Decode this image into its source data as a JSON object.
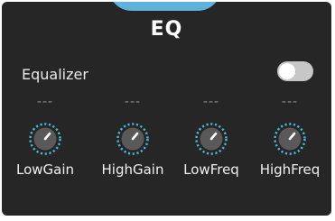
{
  "header": {
    "title": "EQ"
  },
  "equalizer": {
    "label": "Equalizer",
    "enabled": false
  },
  "knobs": [
    {
      "label": "LowGain",
      "value": "---"
    },
    {
      "label": "HighGain",
      "value": "---"
    },
    {
      "label": "LowFreq",
      "value": "---"
    },
    {
      "label": "HighFreq",
      "value": "---"
    }
  ],
  "colors": {
    "panel_bg": "#262626",
    "accent": "#5fb2d9",
    "knob_ring": "#4ab5d4",
    "knob_body": "#595959",
    "text": "#ffffff",
    "muted": "#8c8c8c",
    "toggle_off": "#c7c7c7"
  }
}
